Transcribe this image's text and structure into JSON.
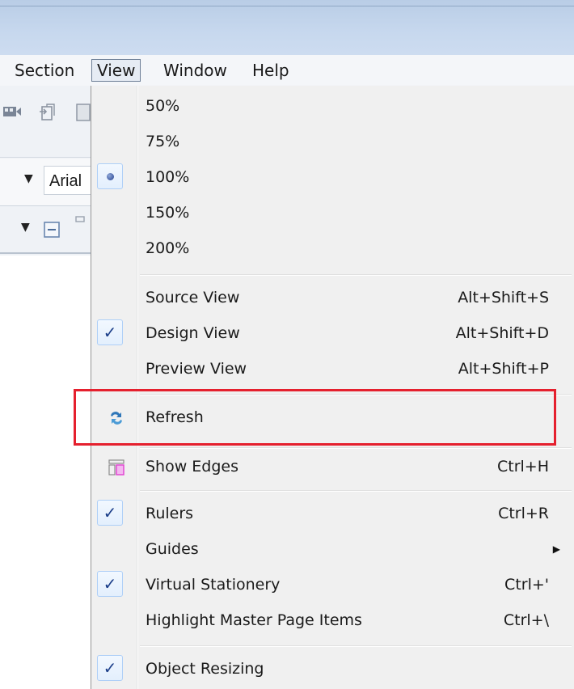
{
  "menubar": {
    "items": [
      {
        "label": "Section"
      },
      {
        "label": "View"
      },
      {
        "label": "Window"
      },
      {
        "label": "Help"
      }
    ]
  },
  "toolbar": {
    "font_name": "Arial"
  },
  "view_menu": {
    "zoom": [
      {
        "label": "50%",
        "selected": false
      },
      {
        "label": "75%",
        "selected": false
      },
      {
        "label": "100%",
        "selected": true
      },
      {
        "label": "150%",
        "selected": false
      },
      {
        "label": "200%",
        "selected": false
      }
    ],
    "views": [
      {
        "label": "Source View",
        "shortcut": "Alt+Shift+S",
        "checked": false
      },
      {
        "label": "Design View",
        "shortcut": "Alt+Shift+D",
        "checked": true
      },
      {
        "label": "Preview View",
        "shortcut": "Alt+Shift+P",
        "checked": false
      }
    ],
    "refresh": {
      "label": "Refresh",
      "icon": "refresh-icon"
    },
    "show_edges": {
      "label": "Show Edges",
      "shortcut": "Ctrl+H",
      "icon": "show-edges-icon"
    },
    "rulers": {
      "label": "Rulers",
      "shortcut": "Ctrl+R",
      "checked": true
    },
    "guides": {
      "label": "Guides",
      "has_submenu": true
    },
    "virtual_stationery": {
      "label": "Virtual Stationery",
      "shortcut": "Ctrl+'",
      "checked": true
    },
    "highlight_master": {
      "label": "Highlight Master Page Items",
      "shortcut": "Ctrl+\\",
      "checked": false
    },
    "object_resizing": {
      "label": "Object Resizing",
      "checked": true
    }
  },
  "colors": {
    "highlight_box": "#e5202e",
    "check_mark": "#1c3f8a",
    "title_bar": "#c7d8ee"
  }
}
